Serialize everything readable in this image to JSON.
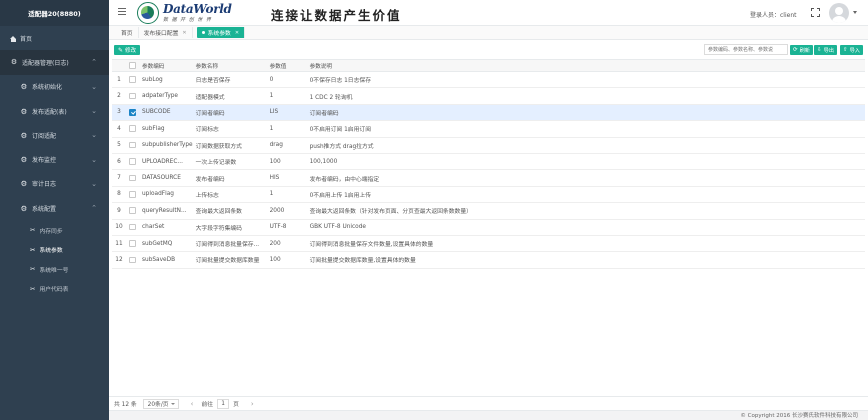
{
  "app": {
    "title": "适配器20(8880)",
    "logo_main": "DataWorld",
    "logo_sub": "数 据 开 创 世 界",
    "slogan": "连接让数据产生价值",
    "login_label": "登录人员：client"
  },
  "sidebar": {
    "home": "首页",
    "group": "适配器管理(日志)",
    "items": [
      {
        "label": "系统初始化"
      },
      {
        "label": "发布适配(表)"
      },
      {
        "label": "订阅适配"
      },
      {
        "label": "发布监控"
      },
      {
        "label": "审计日志"
      },
      {
        "label": "系统配置"
      }
    ],
    "sub_items": [
      {
        "label": "内存同步"
      },
      {
        "label": "系统参数"
      },
      {
        "label": "系统唯一号"
      },
      {
        "label": "用户代码表"
      }
    ]
  },
  "tabs": [
    {
      "label": "首页"
    },
    {
      "label": "发布接口配置"
    },
    {
      "label": "系统参数"
    }
  ],
  "toolbar": {
    "edit_label": "修改",
    "search_placeholder": "参数编码、参数名称、参数说",
    "refresh_label": "刷新",
    "export_label": "导出",
    "import_label": "导入"
  },
  "table": {
    "headers": [
      "参数编码",
      "参数名称",
      "参数值",
      "参数说明"
    ],
    "rows": [
      {
        "idx": "1",
        "code": "subLog",
        "name": "日志是否保存",
        "value": "0",
        "desc": "0不保存日志 1日志保存"
      },
      {
        "idx": "2",
        "code": "adpaterType",
        "name": "适配器模式",
        "value": "1",
        "desc": "1 CDC 2 轮询机"
      },
      {
        "idx": "3",
        "code": "SUBCODE",
        "name": "订阅者编码",
        "value": "LIS",
        "desc": "订阅者编码"
      },
      {
        "idx": "4",
        "code": "subFlag",
        "name": "订阅标志",
        "value": "1",
        "desc": "0不启用订阅 1启用订阅"
      },
      {
        "idx": "5",
        "code": "subpublisherType",
        "name": "订阅数据获取方式",
        "value": "drag",
        "desc": "push推方式 drag拉方式"
      },
      {
        "idx": "6",
        "code": "UPLOADREC...",
        "name": "一次上传记录数",
        "value": "100",
        "desc": "100,1000"
      },
      {
        "idx": "7",
        "code": "DATASOURCE",
        "name": "发布者编码",
        "value": "HIS",
        "desc": "发布者编码，由中心端指定"
      },
      {
        "idx": "8",
        "code": "uploadFlag",
        "name": "上传标志",
        "value": "1",
        "desc": "0不启用上传 1启用上传"
      },
      {
        "idx": "9",
        "code": "queryResultN...",
        "name": "查询最大返回条数",
        "value": "2000",
        "desc": "查询最大返回条数（针对发布页面、分页查最大返回条数数量）"
      },
      {
        "idx": "10",
        "code": "charSet",
        "name": "大字段字符集编码",
        "value": "UTF-8",
        "desc": "GBK UTF-8 Unicode"
      },
      {
        "idx": "11",
        "code": "subGetMQ",
        "name": "订阅得到消息批量保存...",
        "value": "200",
        "desc": "订阅得到消息批量保存文件数量,设置具体的数量"
      },
      {
        "idx": "12",
        "code": "subSaveDB",
        "name": "订阅批量提交数据库数量",
        "value": "100",
        "desc": "订阅批量提交数据库数量,设置具体的数量"
      }
    ]
  },
  "pager": {
    "total": "共 12 条",
    "page_size": "20条/页",
    "goto_label": "前往",
    "current_page": "1",
    "page_suffix": "页"
  },
  "footer": {
    "copyright": "© Copyright 2016 长沙赛氏软件科技有限公司"
  }
}
